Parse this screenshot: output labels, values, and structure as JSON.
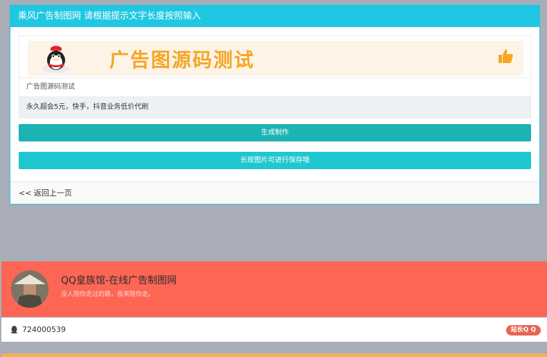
{
  "panel": {
    "header_title": "乘风广告制图网 请根据提示文字长度按照输入",
    "ad_banner_text": "广告图源码测试",
    "field_1_value": "广告图源码测试",
    "field_2_value": "永久超会5元，快手，抖音业务低价代刷",
    "make_button_label": "生成制作",
    "save_button_label": "长按图片可进行保存哦",
    "back_link": "<< 返回上一页"
  },
  "profile": {
    "site_name": "QQ皇族馆-在线广告制图网",
    "motto": "没人陪你走过的路，我来陪你走。",
    "qq_number": "724000539",
    "contact_badge": "站长Q Q"
  },
  "colors": {
    "header": "#1fc7e3",
    "make_button": "#1bb3b3",
    "save_button": "#1fc7d0",
    "profile_bg": "#fd6655",
    "badge": "#e86455",
    "page_bg": "#a9adb8"
  },
  "icons": [
    "qq-penguin-icon",
    "thumbs-up-icon",
    "avatar-photo",
    "qq-small-icon"
  ]
}
